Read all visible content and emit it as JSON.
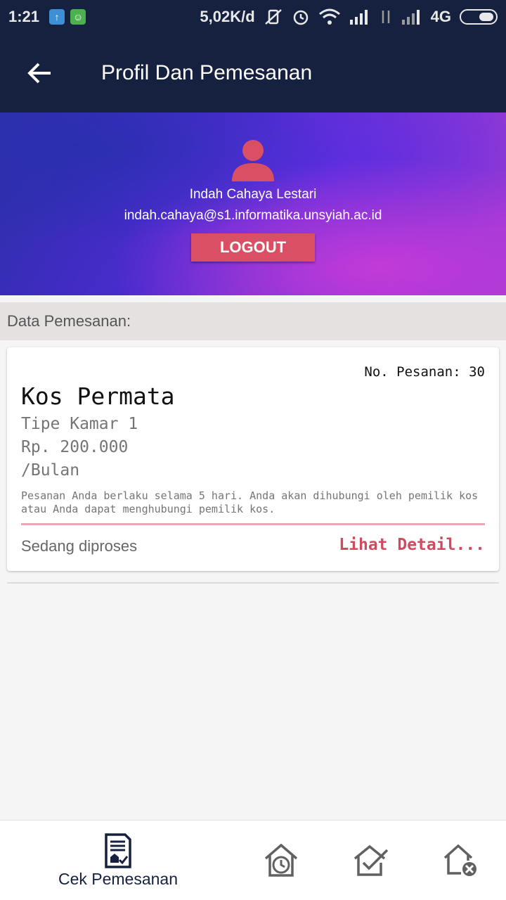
{
  "status_bar": {
    "time": "1:21",
    "network_speed": "5,02K/d",
    "network_type": "4G"
  },
  "app_bar": {
    "title": "Profil Dan Pemesanan"
  },
  "profile": {
    "name": "Indah Cahaya Lestari",
    "email": "indah.cahaya@s1.informatika.unsyiah.ac.id",
    "logout_label": "LOGOUT"
  },
  "section": {
    "title": "Data Pemesanan:"
  },
  "order": {
    "number_label": "No. Pesanan: 30",
    "kos_name": "Kos Permata",
    "room_type": "Tipe Kamar 1",
    "price": "Rp. 200.000",
    "period": "/Bulan",
    "note": "Pesanan Anda berlaku selama 5 hari. Anda akan dihubungi oleh pemilik kos atau Anda dapat menghubungi pemilik kos.",
    "status": "Sedang diproses",
    "detail_link": "Lihat Detail..."
  },
  "bottom_nav": {
    "items": [
      {
        "label": "Cek Pemesanan",
        "icon": "document-house-icon",
        "active": true
      },
      {
        "label": "",
        "icon": "house-clock-icon",
        "active": false
      },
      {
        "label": "",
        "icon": "house-check-icon",
        "active": false
      },
      {
        "label": "",
        "icon": "house-cancel-icon",
        "active": false
      }
    ]
  },
  "colors": {
    "primary_dark": "#16213f",
    "accent_red": "#d94f63",
    "link_red": "#d24a5d"
  }
}
